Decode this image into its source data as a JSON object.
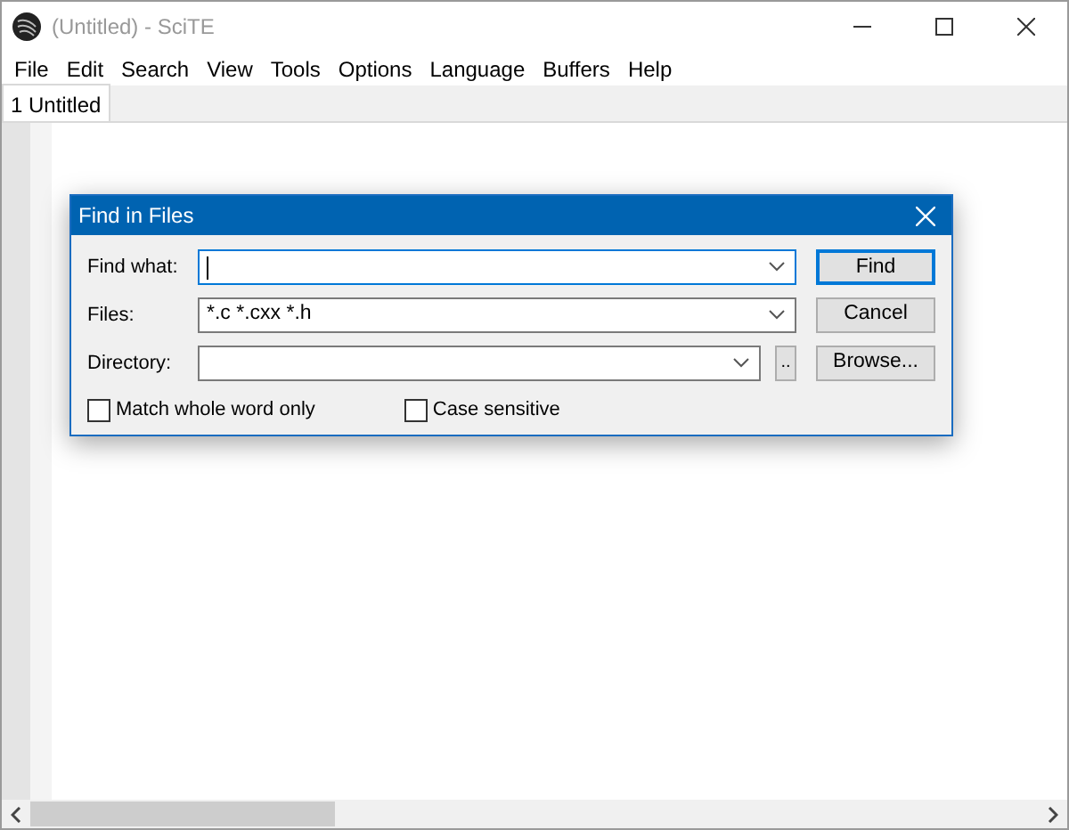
{
  "window": {
    "title": "(Untitled) - SciTE"
  },
  "menu": [
    "File",
    "Edit",
    "Search",
    "View",
    "Tools",
    "Options",
    "Language",
    "Buffers",
    "Help"
  ],
  "tabs": [
    {
      "label": "1 Untitled",
      "selected": true
    }
  ],
  "dialog": {
    "title": "Find in Files",
    "fields": [
      {
        "label": "Find what:",
        "focused": true
      },
      {
        "label": "Files:",
        "value": "*.c *.cxx *.h",
        "focused": false
      },
      {
        "label": "Directory:",
        "focused": false,
        "browse_label": ".."
      }
    ],
    "buttons": [
      {
        "label": "Find",
        "default": true
      },
      {
        "label": "Cancel",
        "default": false
      },
      {
        "label": "Browse...",
        "default": false
      }
    ],
    "checkboxes": [
      {
        "label": "Match whole word only",
        "checked": false
      },
      {
        "label": "Case sensitive",
        "checked": false
      }
    ]
  }
}
